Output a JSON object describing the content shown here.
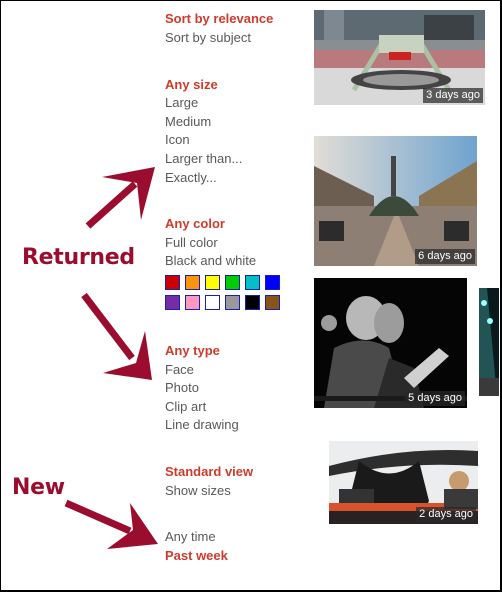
{
  "sort": [
    {
      "label": "Sort by relevance",
      "selected": true
    },
    {
      "label": "Sort by subject",
      "selected": false
    }
  ],
  "size": [
    {
      "label": "Any size",
      "selected": true
    },
    {
      "label": "Large",
      "selected": false
    },
    {
      "label": "Medium",
      "selected": false
    },
    {
      "label": "Icon",
      "selected": false
    },
    {
      "label": "Larger than...",
      "selected": false
    },
    {
      "label": "Exactly...",
      "selected": false
    }
  ],
  "color": [
    {
      "label": "Any color",
      "selected": true
    },
    {
      "label": "Full color",
      "selected": false
    },
    {
      "label": "Black and white",
      "selected": false
    }
  ],
  "swatches": [
    {
      "name": "red",
      "hex": "#cc0000"
    },
    {
      "name": "orange",
      "hex": "#fb940b"
    },
    {
      "name": "yellow",
      "hex": "#ffff00"
    },
    {
      "name": "green",
      "hex": "#00cc00"
    },
    {
      "name": "teal",
      "hex": "#03c0c6"
    },
    {
      "name": "blue",
      "hex": "#0000ff"
    },
    {
      "name": "purple",
      "hex": "#762ca7"
    },
    {
      "name": "pink",
      "hex": "#ff98bf"
    },
    {
      "name": "white",
      "hex": "#ffffff"
    },
    {
      "name": "gray",
      "hex": "#999999"
    },
    {
      "name": "black",
      "hex": "#000000"
    },
    {
      "name": "brown",
      "hex": "#885418"
    }
  ],
  "type": [
    {
      "label": "Any type",
      "selected": true
    },
    {
      "label": "Face",
      "selected": false
    },
    {
      "label": "Photo",
      "selected": false
    },
    {
      "label": "Clip art",
      "selected": false
    },
    {
      "label": "Line drawing",
      "selected": false
    }
  ],
  "view": [
    {
      "label": "Standard view",
      "selected": true
    },
    {
      "label": "Show sizes",
      "selected": false
    }
  ],
  "time": [
    {
      "label": "Any time",
      "selected": false
    },
    {
      "label": "Past week",
      "selected": true
    }
  ],
  "annotations": {
    "returned": "Returned",
    "new": "New",
    "color": "#9b0d2e"
  },
  "results": [
    {
      "age": "3 days ago",
      "description": "concert stage in stadium"
    },
    {
      "age": "6 days ago",
      "description": "stadium stage under sky"
    },
    {
      "age": "5 days ago",
      "description": "guitarists black and white"
    },
    {
      "age": "",
      "description": "stage lights (partially visible)"
    },
    {
      "age": "2 days ago",
      "description": "stage structure close-up"
    }
  ],
  "colors": {
    "selected_text": "#cd3b2c",
    "option_text": "#595959",
    "swatch_border": "#1b1fb0"
  }
}
